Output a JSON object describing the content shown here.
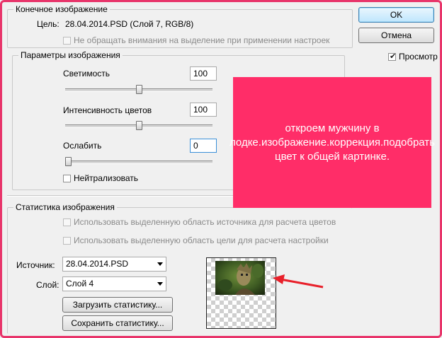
{
  "target_group": {
    "legend": "Конечное изображение",
    "target_label": "Цель:",
    "target_value": "28.04.2014.PSD (Слой 7, RGB/8)",
    "ignore_selection_label": "Не обращать внимания на выделение при применении настроек"
  },
  "image_options": {
    "legend": "Параметры изображения",
    "luminance_label": "Светимость",
    "luminance_value": "100",
    "luminance_level": 0.5,
    "color_intensity_label": "Интенсивность цветов",
    "color_intensity_value": "100",
    "color_intensity_level": 0.5,
    "fade_label": "Ослабить",
    "fade_value": "0",
    "fade_level": 0,
    "neutralize_label": "Нейтрализовать"
  },
  "statistics": {
    "legend": "Статистика изображения",
    "use_source_selection_label": "Использовать выделенную область источника для расчета цветов",
    "use_target_selection_label": "Использовать выделенную область цели для расчета настройки",
    "source_label": "Источник:",
    "source_value": "28.04.2014.PSD",
    "layer_label": "Слой:",
    "layer_value": "Слой 4",
    "load_stats_label": "Загрузить статистику...",
    "save_stats_label": "Сохранить статистику..."
  },
  "buttons": {
    "ok_label": "OK",
    "cancel_label": "Отмена",
    "preview_label": "Просмотр"
  },
  "annotation": {
    "text": "откроем мужчину в лодке.изображение.коррекция.подобрать цвет к общей картинке."
  },
  "colors": {
    "annotation_bg": "#ff2d68",
    "frame": "#e8346a",
    "arrow": "#e8202a"
  }
}
